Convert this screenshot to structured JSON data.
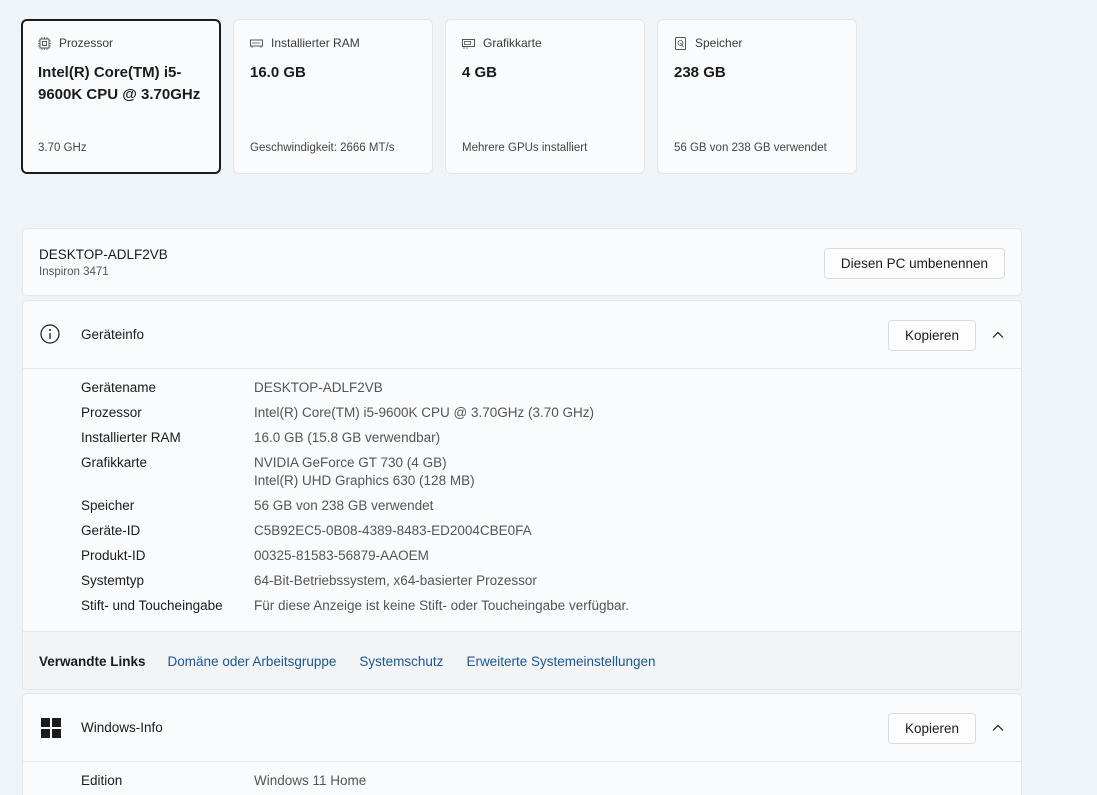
{
  "cards": [
    {
      "title": "Prozessor",
      "value": "Intel(R) Core(TM) i5-9600K CPU @ 3.70GHz",
      "sub": "3.70 GHz"
    },
    {
      "title": "Installierter RAM",
      "value": "16.0 GB",
      "sub": "Geschwindigkeit: 2666 MT/s"
    },
    {
      "title": "Grafikkarte",
      "value": "4 GB",
      "sub": "Mehrere GPUs installiert"
    },
    {
      "title": "Speicher",
      "value": "238 GB",
      "sub": "56 GB von 238 GB verwendet"
    }
  ],
  "pc": {
    "name": "DESKTOP-ADLF2VB",
    "model": "Inspiron 3471",
    "rename_label": "Diesen PC umbenennen"
  },
  "device_info": {
    "title": "Geräteinfo",
    "copy_label": "Kopieren",
    "rows": [
      {
        "key": "Gerätename",
        "value": "DESKTOP-ADLF2VB"
      },
      {
        "key": "Prozessor",
        "value": "Intel(R) Core(TM) i5-9600K CPU @ 3.70GHz (3.70 GHz)"
      },
      {
        "key": "Installierter RAM",
        "value": "16.0 GB (15.8 GB verwendbar)"
      },
      {
        "key": "Grafikkarte",
        "value": "NVIDIA GeForce GT 730 (4 GB)",
        "value2": "Intel(R) UHD Graphics 630 (128 MB)"
      },
      {
        "key": "Speicher",
        "value": "56 GB von 238 GB verwendet"
      },
      {
        "key": "Geräte-ID",
        "value": "C5B92EC5-0B08-4389-8483-ED2004CBE0FA"
      },
      {
        "key": "Produkt-ID",
        "value": "00325-81583-56879-AAOEM"
      },
      {
        "key": "Systemtyp",
        "value": "64-Bit-Betriebssystem, x64-basierter Prozessor"
      },
      {
        "key": "Stift- und Toucheingabe",
        "value": "Für diese Anzeige ist keine Stift- oder Toucheingabe verfügbar."
      }
    ]
  },
  "related_links": {
    "label": "Verwandte Links",
    "links": [
      "Domäne oder Arbeitsgruppe",
      "Systemschutz",
      "Erweiterte Systemeinstellungen"
    ]
  },
  "windows_info": {
    "title": "Windows-Info",
    "copy_label": "Kopieren",
    "rows": [
      {
        "key": "Edition",
        "value": "Windows 11 Home"
      }
    ]
  },
  "icons": {
    "card0": "cpu-icon",
    "card1": "ram-icon",
    "card2": "gpu-icon",
    "card3": "storage-icon",
    "device_info": "info-icon",
    "windows_info": "windows-logo-icon",
    "collapse": "chevron-up-icon"
  },
  "colors": {
    "link": "#1a5799",
    "background": "#eff4f9"
  }
}
